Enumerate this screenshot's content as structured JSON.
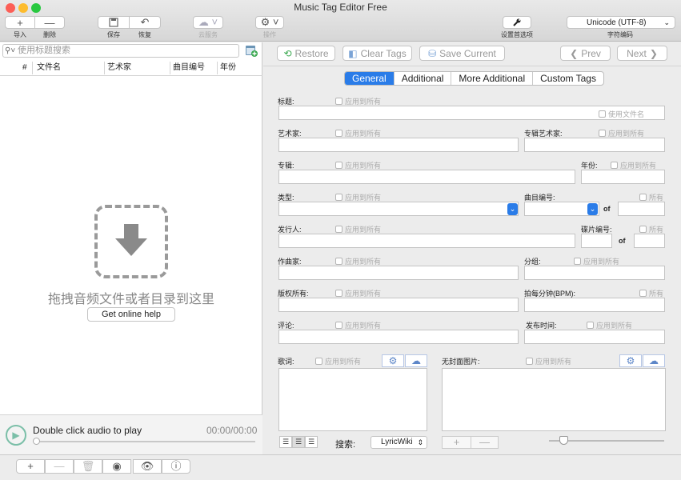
{
  "window": {
    "title": "Music Tag Editor Free"
  },
  "toolbar": {
    "import": "导入",
    "delete": "删除",
    "save": "保存",
    "restore": "恢复",
    "cloud": "云服务",
    "action": "操作",
    "prefs": "设置首选项",
    "encoding_value": "Unicode (UTF-8)",
    "encoding_label": "字符编码"
  },
  "left": {
    "search_placeholder": "使用标题搜索",
    "columns": [
      "#",
      "文件名",
      "艺术家",
      "曲目编号",
      "年份"
    ],
    "drop_text": "拖拽音频文件或者目录到这里",
    "help_button": "Get online help",
    "player_text": "Double click audio to play",
    "player_time": "00:00/00:00"
  },
  "nav": {
    "restore": "Restore",
    "clear": "Clear Tags",
    "save_current": "Save Current",
    "prev": "Prev",
    "next": "Next"
  },
  "tabs": [
    "General",
    "Additional",
    "More Additional",
    "Custom Tags"
  ],
  "form": {
    "apply_all": "应用到所有",
    "all": "所有",
    "use_filename": "使用文件名",
    "of": "of",
    "title": "标题:",
    "artist": "艺术家:",
    "album_artist": "专辑艺术家:",
    "album": "专辑:",
    "year": "年份:",
    "genre": "类型:",
    "track": "曲目编号:",
    "publisher": "发行人:",
    "disc": "碟片编号:",
    "composer": "作曲家:",
    "grouping": "分组:",
    "copyright": "版权所有:",
    "bpm": "拍每分钟(BPM):",
    "comment": "评论:",
    "release_time": "发布时间:",
    "lyrics": "歌词:",
    "no_cover": "无封面图片:",
    "search_label": "搜索:",
    "search_source": "LyricWiki"
  },
  "colors": {
    "accent": "#2a7ce8",
    "play": "#7bbfa8"
  }
}
